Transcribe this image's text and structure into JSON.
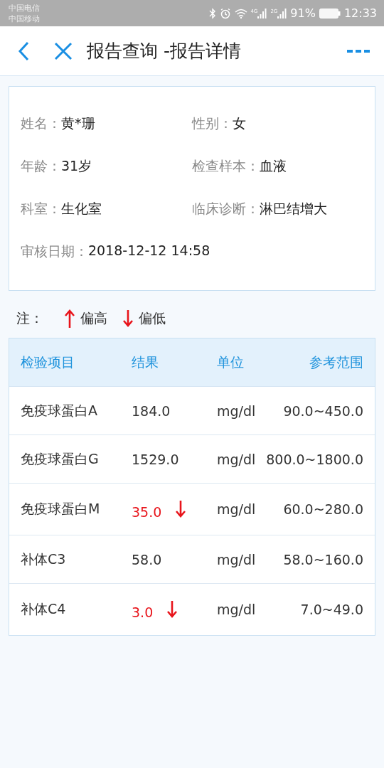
{
  "status_bar": {
    "carriers": [
      "中国电信",
      "中国移动"
    ],
    "network_labels": [
      "4G",
      "2G"
    ],
    "battery": "91%",
    "time": "12:33"
  },
  "header": {
    "title": "报告查询 -报告详情"
  },
  "patient": [
    {
      "label": "姓名：",
      "value": "黄*珊"
    },
    {
      "label": "性别：",
      "value": "女"
    },
    {
      "label": "年龄：",
      "value": "31岁"
    },
    {
      "label": "检查样本：",
      "value": "血液"
    },
    {
      "label": "科室：",
      "value": "生化室"
    },
    {
      "label": "临床诊断：",
      "value": "淋巴结增大"
    },
    {
      "label": "审核日期：",
      "value": "2018-12-12 14:58"
    }
  ],
  "legend": {
    "label": "注：",
    "items": [
      {
        "low": false,
        "text": "偏高"
      },
      {
        "low": true,
        "text": "偏低"
      }
    ]
  },
  "table": {
    "columns": [
      "检验项目",
      "结果",
      "单位",
      "参考范围"
    ],
    "rows": [
      {
        "item": "免疫球蛋白A",
        "result": "184.0",
        "low": false,
        "unit": "mg/dl",
        "range": "90.0~450.0"
      },
      {
        "item": "免疫球蛋白G",
        "result": "1529.0",
        "low": false,
        "unit": "mg/dl",
        "range": "800.0~1800.0"
      },
      {
        "item": "免疫球蛋白M",
        "result": "35.0",
        "low": true,
        "unit": "mg/dl",
        "range": "60.0~280.0"
      },
      {
        "item": "补体C3",
        "result": "58.0",
        "low": false,
        "unit": "mg/dl",
        "range": "58.0~160.0"
      },
      {
        "item": "补体C4",
        "result": "3.0",
        "low": true,
        "unit": "mg/dl",
        "range": "7.0~49.0"
      }
    ]
  }
}
